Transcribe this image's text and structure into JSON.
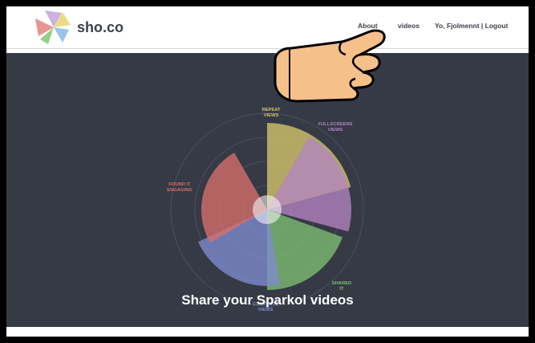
{
  "header": {
    "logo_text": "sho.co",
    "nav": {
      "about": "About",
      "videos": "videos",
      "user": "Yo, Fjolmennt | Logout"
    }
  },
  "hero": {
    "tagline": "Share your Sparkol videos",
    "bg_color": "#353a45"
  },
  "chart_data": {
    "type": "polar-area",
    "categories": [
      {
        "label_lines": [
          "REPEAT",
          "VIEWS"
        ],
        "color": "#d6c66b"
      },
      {
        "label_lines": [
          "FULLSCREENS",
          "VIEWS"
        ],
        "color": "#b584c0"
      },
      {
        "label_lines": [
          "SHARED",
          "IT"
        ],
        "color": "#7fbf71"
      },
      {
        "label_lines": [
          "COMPLETE",
          "VIEWS"
        ],
        "color": "#7f8ccf"
      },
      {
        "label_lines": [
          "FOUND IT",
          "ENGAGING"
        ],
        "color": "#d8706b"
      }
    ]
  },
  "icons": {
    "logo": "sho-co-logo-icon",
    "cursor": "pointing-hand-cursor-icon"
  }
}
